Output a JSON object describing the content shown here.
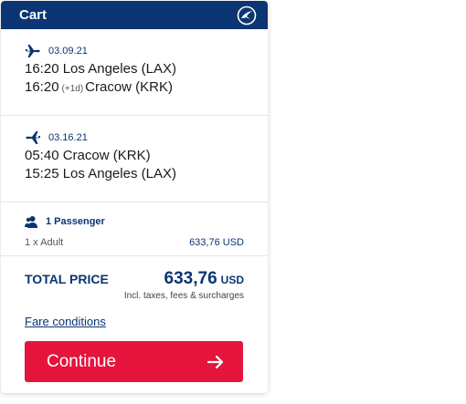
{
  "cart": {
    "title": "Cart",
    "brand_color": "#0b3573",
    "accent_color": "#e4143c",
    "header_icon": "crane-logo-icon"
  },
  "flights": [
    {
      "direction_icon": "plane-departure-icon",
      "date": "03.09.21",
      "departure": {
        "time": "16:20",
        "place": "Los Angeles (LAX)"
      },
      "arrival": {
        "time": "16:20",
        "offset": "(+1d)",
        "place": "Cracow (KRK)"
      }
    },
    {
      "direction_icon": "plane-return-icon",
      "date": "03.16.21",
      "departure": {
        "time": "05:40",
        "place": "Cracow (KRK)"
      },
      "arrival": {
        "time": "15:25",
        "place": "Los Angeles (LAX)"
      }
    }
  ],
  "passengers": {
    "label": "1 Passenger",
    "line_type": "1 x Adult",
    "line_price": "633,76 USD"
  },
  "total": {
    "label": "TOTAL PRICE",
    "amount": "633,76",
    "currency": "USD",
    "note": "Incl. taxes, fees & surcharges"
  },
  "fare_conditions": "Fare conditions",
  "continue_label": "Continue"
}
